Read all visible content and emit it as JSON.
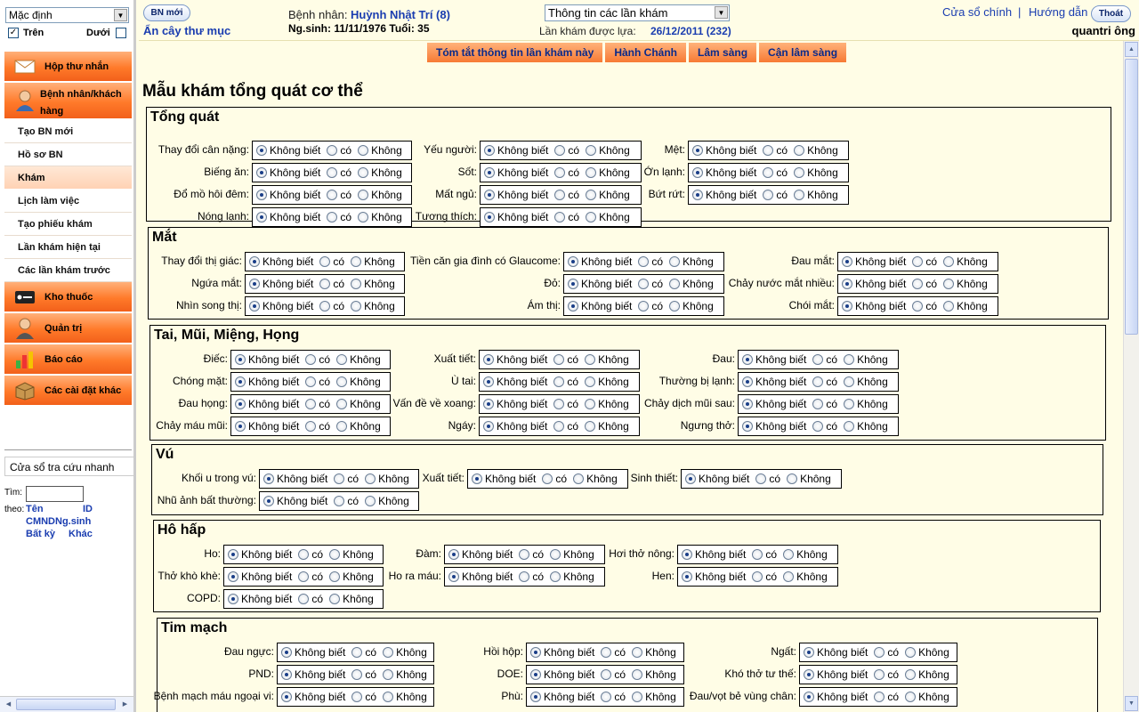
{
  "left": {
    "view_select": "Mặc định",
    "opt_top": "Trên",
    "opt_top_checked": true,
    "opt_bottom": "Dưới",
    "opt_bottom_checked": false,
    "menu": {
      "inbox": "Hộp thư nhắn",
      "patients": "Bệnh nhân/khách hàng",
      "new_patient": "Tạo BN mới",
      "records": "Hồ sơ BN",
      "exam": "Khám",
      "schedule": "Lịch làm việc",
      "create_form": "Tạo phiếu khám",
      "current_visit": "Lần khám hiện tại",
      "previous_visits": "Các lần khám trước",
      "pharmacy": "Kho thuốc",
      "admin": "Quản trị",
      "reports": "Báo cáo",
      "other_settings": "Các cài đặt khác"
    },
    "quick": {
      "title": "Cửa sổ tra cứu nhanh",
      "find": "Tìm:",
      "by": "theo:",
      "name": "Tên",
      "id": "ID",
      "cmnd": "CMND",
      "dob": "Ng.sinh",
      "any": "Bất kỳ",
      "other": "Khác"
    }
  },
  "header": {
    "new_btn": "BN mới",
    "hide_tree": "Ẩn cây thư mục",
    "patient_label": "Bệnh nhân:",
    "patient_name": "Huỳnh Nhật Trí (8)",
    "dob_label": "Ng.sinh: 11/11/1976 Tuổi: 35",
    "visits_select": "Thông tin các lần khám",
    "chosen_label": "Lần khám được lựa:",
    "chosen_value": "26/12/2011 (232)",
    "main_window": "Cửa sổ chính",
    "sep": "|",
    "guide": "Hướng dẫn",
    "logout": "Thoát",
    "user": "quantri ông"
  },
  "tabs": [
    "Tóm tắt thông tin lần khám này",
    "Hành Chánh",
    "Lâm sàng",
    "Cận lâm sàng"
  ],
  "opts": {
    "u": "Không biết",
    "y": "có",
    "n": "Không"
  },
  "form_title": "Mẫu khám tổng quát cơ thể",
  "sections": {
    "general": {
      "title": "Tổng quát",
      "f": [
        "Thay đổi cân nặng:",
        "Biếng ăn:",
        "Đổ mồ hôi đêm:",
        "Nóng lạnh:",
        "Yếu người:",
        "Sốt:",
        "Mất ngủ:",
        "Tương thích:",
        "Mệt:",
        "Ớn lạnh:",
        "Bứt rứt:"
      ]
    },
    "eye": {
      "title": "Mắt",
      "f": [
        "Thay đổi thị giác:",
        "Ngứa mắt:",
        "Nhìn song thị:",
        "Tiền căn gia đình có Glaucome:",
        "Đỏ:",
        "Ám thị:",
        "Đau mắt:",
        "Chảy nước mắt nhiều:",
        "Chói mắt:"
      ]
    },
    "ent": {
      "title": "Tai, Mũi, Miệng, Họng",
      "f": [
        "Điếc:",
        "Chóng mặt:",
        "Đau họng:",
        "Chảy máu mũi:",
        "Xuất tiết:",
        "Ù tai:",
        "Vấn đề về xoang:",
        "Ngáy:",
        "Đau:",
        "Thường bị lạnh:",
        "Chảy dịch mũi sau:",
        "Ngưng thở:"
      ]
    },
    "breast": {
      "title": "Vú",
      "f": [
        "Khối u trong vú:",
        "Nhũ ảnh bất thường:",
        "Xuất tiết:",
        "Sinh thiết:"
      ]
    },
    "resp": {
      "title": "Hô hấp",
      "f": [
        "Ho:",
        "Thở khò khè:",
        "COPD:",
        "Đàm:",
        "Ho ra máu:",
        "Hơi thở nông:",
        "Hen:"
      ]
    },
    "cardio": {
      "title": "Tim mạch",
      "f": [
        "Đau ngực:",
        "PND:",
        "Bệnh mạch máu ngoại vi:",
        "Hồi hộp:",
        "DOE:",
        "Phù:",
        "Ngất:",
        "Khó thở tư thế:",
        "Đau/vọt bẻ vùng chân:"
      ]
    }
  }
}
